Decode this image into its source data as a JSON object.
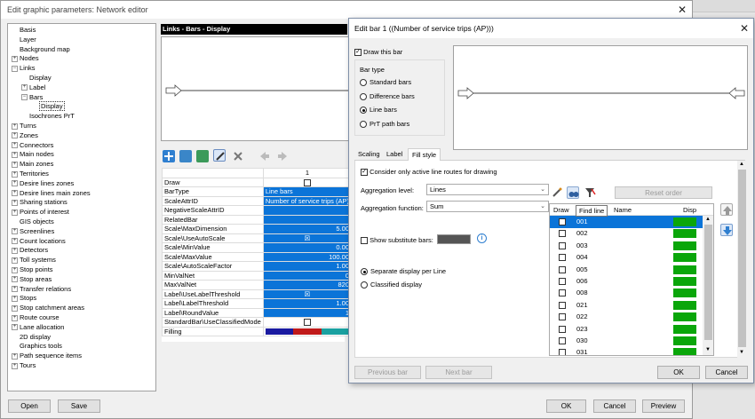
{
  "main_window": {
    "title": "Edit graphic parameters: Network editor",
    "close_glyph": "✕",
    "tree": [
      {
        "label": "Basis",
        "level": 0,
        "expander": ""
      },
      {
        "label": "Layer",
        "level": 0,
        "expander": ""
      },
      {
        "label": "Background map",
        "level": 0,
        "expander": ""
      },
      {
        "label": "Nodes",
        "level": 0,
        "expander": "+"
      },
      {
        "label": "Links",
        "level": 0,
        "expander": "−"
      },
      {
        "label": "Display",
        "level": 1,
        "expander": ""
      },
      {
        "label": "Label",
        "level": 1,
        "expander": "+"
      },
      {
        "label": "Bars",
        "level": 1,
        "expander": "−"
      },
      {
        "label": "Display",
        "level": 2,
        "expander": "",
        "selected": true
      },
      {
        "label": "Isochrones PrT",
        "level": 1,
        "expander": ""
      },
      {
        "label": "Turns",
        "level": 0,
        "expander": "+"
      },
      {
        "label": "Zones",
        "level": 0,
        "expander": "+"
      },
      {
        "label": "Connectors",
        "level": 0,
        "expander": "+"
      },
      {
        "label": "Main nodes",
        "level": 0,
        "expander": "+"
      },
      {
        "label": "Main zones",
        "level": 0,
        "expander": "+"
      },
      {
        "label": "Territories",
        "level": 0,
        "expander": "+"
      },
      {
        "label": "Desire lines zones",
        "level": 0,
        "expander": "+"
      },
      {
        "label": "Desire lines main zones",
        "level": 0,
        "expander": "+"
      },
      {
        "label": "Sharing stations",
        "level": 0,
        "expander": "+"
      },
      {
        "label": "Points of interest",
        "level": 0,
        "expander": "+"
      },
      {
        "label": "GIS objects",
        "level": 0,
        "expander": ""
      },
      {
        "label": "Screenlines",
        "level": 0,
        "expander": "+"
      },
      {
        "label": "Count locations",
        "level": 0,
        "expander": "+"
      },
      {
        "label": "Detectors",
        "level": 0,
        "expander": "+"
      },
      {
        "label": "Toll systems",
        "level": 0,
        "expander": "+"
      },
      {
        "label": "Stop points",
        "level": 0,
        "expander": "+"
      },
      {
        "label": "Stop areas",
        "level": 0,
        "expander": "+"
      },
      {
        "label": "Transfer relations",
        "level": 0,
        "expander": "+"
      },
      {
        "label": "Stops",
        "level": 0,
        "expander": "+"
      },
      {
        "label": "Stop catchment areas",
        "level": 0,
        "expander": "+"
      },
      {
        "label": "Route course",
        "level": 0,
        "expander": "+"
      },
      {
        "label": "Lane allocation",
        "level": 0,
        "expander": "+"
      },
      {
        "label": "2D display",
        "level": 0,
        "expander": ""
      },
      {
        "label": "Graphics tools",
        "level": 0,
        "expander": ""
      },
      {
        "label": "Path sequence items",
        "level": 0,
        "expander": "+"
      },
      {
        "label": "Tours",
        "level": 0,
        "expander": "+"
      }
    ],
    "panel_header": "Links - Bars - Display",
    "grid_column": "1",
    "grid_rows": [
      {
        "label": "Draw",
        "value": "",
        "kind": "checkbox"
      },
      {
        "label": "BarType",
        "value": "Line bars",
        "kind": "text"
      },
      {
        "label": "ScaleAttrID",
        "value": "Number of service trips (AP)",
        "kind": "text"
      },
      {
        "label": "NegativeScaleAttrID",
        "value": "",
        "kind": "text"
      },
      {
        "label": "RelatedBar",
        "value": "",
        "kind": "text"
      },
      {
        "label": "Scale\\MaxDimension",
        "value": "5.00",
        "kind": "num"
      },
      {
        "label": "Scale\\UseAutoScale",
        "value": "☒",
        "kind": "check"
      },
      {
        "label": "Scale\\MinValue",
        "value": "0.00",
        "kind": "num"
      },
      {
        "label": "Scale\\MaxValue",
        "value": "100.00",
        "kind": "num"
      },
      {
        "label": "Scale\\AutoScaleFactor",
        "value": "1.00",
        "kind": "num"
      },
      {
        "label": "MinValNet",
        "value": "0",
        "kind": "num"
      },
      {
        "label": "MaxValNet",
        "value": "820",
        "kind": "num"
      },
      {
        "label": "Label\\UseLabelThreshold",
        "value": "☒",
        "kind": "check"
      },
      {
        "label": "Label\\LabelThreshold",
        "value": "1.00",
        "kind": "num"
      },
      {
        "label": "Label\\RoundValue",
        "value": "1",
        "kind": "num"
      },
      {
        "label": "StandardBar\\UseClassifiedMode",
        "value": "",
        "kind": "checkbox"
      },
      {
        "label": "Filling",
        "value": "",
        "kind": "fill"
      }
    ],
    "buttons": {
      "open": "Open",
      "save": "Save",
      "ok": "OK",
      "cancel": "Cancel",
      "preview": "Preview"
    }
  },
  "dialog": {
    "title": "Edit bar 1 ((Number of service trips (AP)))",
    "close_glyph": "✕",
    "draw_this_bar": "Draw this bar",
    "bar_type_label": "Bar type",
    "bar_types": [
      "Standard bars",
      "Difference bars",
      "Line bars",
      "PrT path bars"
    ],
    "bar_type_selected": "Line bars",
    "tabs": [
      "Scaling",
      "Label",
      "Fill style"
    ],
    "active_tab": "Fill style",
    "consider_active": "Consider only active line routes for drawing",
    "aggregation_level_label": "Aggregation level:",
    "aggregation_level_value": "Lines",
    "aggregation_function_label": "Aggregation function:",
    "aggregation_function_value": "Sum",
    "show_substitute_bars": "Show substitute bars:",
    "info_glyph": "i",
    "display_options": [
      "Separate display per Line",
      "Classified display"
    ],
    "display_selected": "Separate display per Line",
    "reset_order": "Reset order",
    "tooltip": "Find line",
    "list_headers": {
      "draw": "Draw",
      "name": "Name",
      "display": "Disp"
    },
    "lines": [
      "001",
      "002",
      "003",
      "004",
      "005",
      "006",
      "008",
      "021",
      "022",
      "023",
      "030",
      "031"
    ],
    "buttons": {
      "previous": "Previous bar",
      "next": "Next bar",
      "ok": "OK",
      "cancel": "Cancel"
    },
    "colors": {
      "bar_fill": "#0aa60a",
      "selection": "#0b74d8"
    }
  }
}
